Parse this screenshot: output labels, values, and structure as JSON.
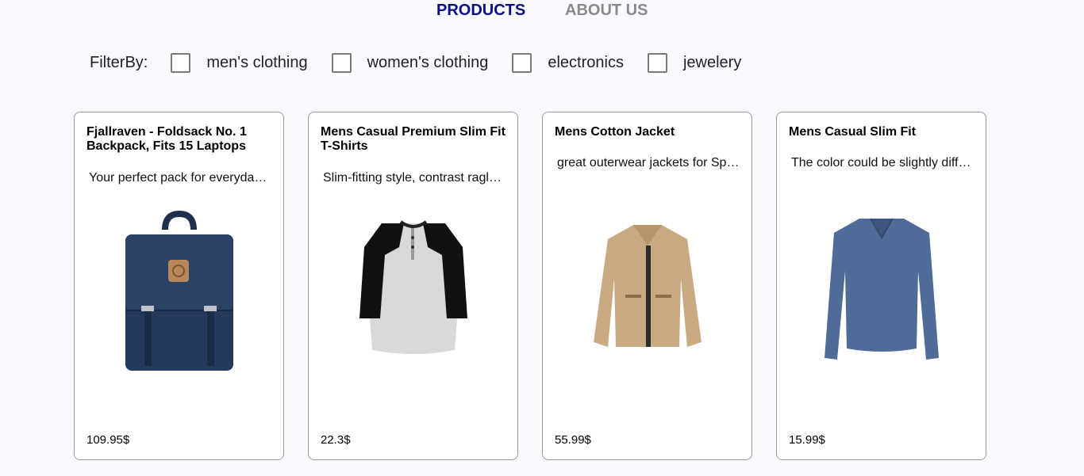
{
  "nav": {
    "products": "PRODUCTS",
    "about": "ABOUT US"
  },
  "filter": {
    "label": "FilterBy:",
    "options": [
      "men's clothing",
      "women's clothing",
      "electronics",
      "jewelery"
    ]
  },
  "products": [
    {
      "title": "Fjallraven - Foldsack No. 1 Backpack, Fits 15 Laptops",
      "description": "Your perfect pack for everyday use and walks in the forest.",
      "price": "109.95$",
      "icon": "backpack-image"
    },
    {
      "title": "Mens Casual Premium Slim Fit T-Shirts",
      "description": "Slim-fitting style, contrast raglan long sleeve",
      "price": "22.3$",
      "icon": "raglan-tshirt-image"
    },
    {
      "title": "Mens Cotton Jacket",
      "description": "great outerwear jackets for Spring/Autumn/Winter",
      "price": "55.99$",
      "icon": "cotton-jacket-image"
    },
    {
      "title": "Mens Casual Slim Fit",
      "description": "The color could be slightly different between on the screen",
      "price": "15.99$",
      "icon": "slim-fit-shirt-image"
    }
  ],
  "colors": {
    "nav_active": "#0d0d86",
    "nav_inactive": "#8a8a8a",
    "background": "#f8fafe"
  }
}
